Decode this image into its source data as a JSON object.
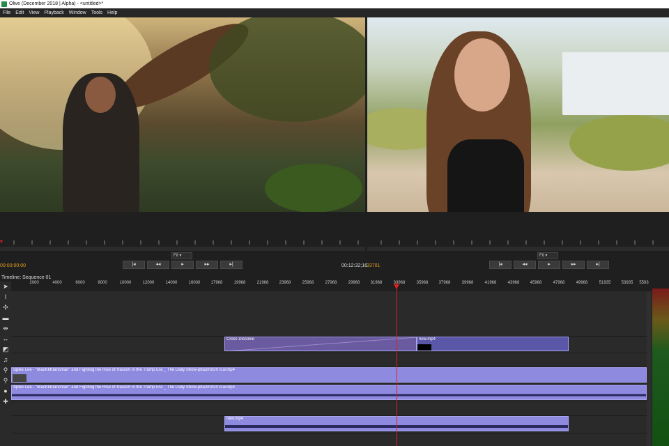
{
  "window": {
    "title": "Olive (December 2018 | Alpha) - <untitled>*"
  },
  "menu": [
    "File",
    "Edit",
    "View",
    "Playback",
    "Window",
    "Tools",
    "Help"
  ],
  "source_viewer": {
    "zoom": "Fit",
    "timecode": "00:00:00:00"
  },
  "sequence_viewer": {
    "zoom": "Fit",
    "timecode": "00:12:32;16",
    "duration": "33701"
  },
  "transport": {
    "buttons": [
      "|◂",
      "◂◂",
      "▸",
      "▸▸",
      "▸|"
    ]
  },
  "timeline": {
    "title": "Timeline: Sequence 01",
    "ticks": [
      "2000",
      "4000",
      "6000",
      "8000",
      "10000",
      "12000",
      "14000",
      "16000",
      "17968",
      "19968",
      "21968",
      "23968",
      "25968",
      "27968",
      "29968",
      "31968",
      "33968",
      "35968",
      "37968",
      "39968",
      "41968",
      "43968",
      "45968",
      "47968",
      "49968",
      "51935",
      "53935",
      "5593"
    ],
    "clips": {
      "transition": "Cross Dissolve",
      "video2": "new.mp4",
      "video1": "Spike Lee - \"BlacKkKlansman\" and Fighting the Rise of Racism in the Trump Era _ The Daily Show-p8a2mzU07Lw.mp4",
      "audio1": "Spike Lee - \"BlacKkKlansman\" and Fighting the Rise of Racism in the Trump Era _ The Daily Show-p8a2mzU07Lw.mp4",
      "audio2": "new.mp4"
    }
  },
  "colors": {
    "playhead": "#e02020",
    "clip": "#8e8ae0",
    "timecode_accent": "#e0a020"
  }
}
